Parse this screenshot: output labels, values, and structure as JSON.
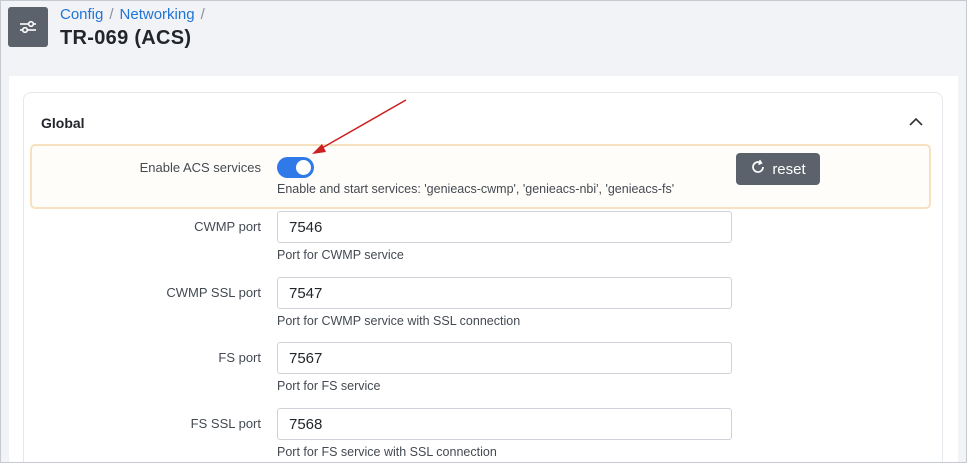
{
  "breadcrumb": {
    "items": [
      "Config",
      "Networking"
    ],
    "separator": "/"
  },
  "page_title": "TR-069 (ACS)",
  "page_icon": "sliders-icon",
  "section": {
    "title": "Global",
    "collapse_icon": "chevron-up-icon"
  },
  "enable_acs": {
    "label": "Enable ACS services",
    "enabled": true,
    "help": "Enable and start services: 'genieacs-cwmp', 'genieacs-nbi', 'genieacs-fs'",
    "reset_label": "reset",
    "reset_icon": "refresh-icon"
  },
  "fields": {
    "cwmp_port": {
      "label": "CWMP port",
      "value": "7546",
      "help": "Port for CWMP service"
    },
    "cwmp_ssl_port": {
      "label": "CWMP SSL port",
      "value": "7547",
      "help": "Port for CWMP service with SSL connection"
    },
    "fs_port": {
      "label": "FS port",
      "value": "7567",
      "help": "Port for FS service"
    },
    "fs_ssl_port": {
      "label": "FS SSL port",
      "value": "7568",
      "help": "Port for FS service with SSL connection"
    }
  },
  "colors": {
    "accent": "#2f79e8",
    "link": "#1f74d6",
    "highlight_border": "#f6e2c0",
    "annotation_arrow": "#cc1f1f",
    "button_bg": "#5b626b"
  }
}
